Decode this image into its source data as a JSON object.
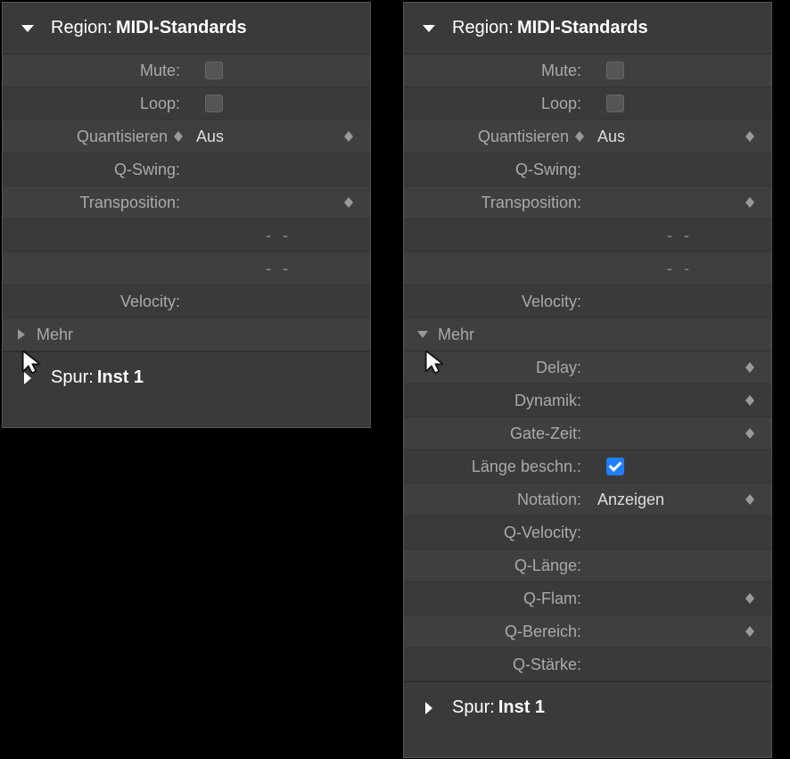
{
  "region": {
    "label": "Region:",
    "value": "MIDI-Standards"
  },
  "spur": {
    "label": "Spur:",
    "value": "Inst 1"
  },
  "mehr": {
    "label": "Mehr"
  },
  "dash": "-   -",
  "rows": {
    "mute": "Mute:",
    "loop": "Loop:",
    "quant": "Quantisieren",
    "quant_val": "Aus",
    "qswing": "Q-Swing:",
    "transp": "Transposition:",
    "velocity": "Velocity:",
    "delay": "Delay:",
    "dynamik": "Dynamik:",
    "gate": "Gate-Zeit:",
    "clip": "Länge beschn.:",
    "notation": "Notation:",
    "notation_val": "Anzeigen",
    "qvel": "Q-Velocity:",
    "qlen": "Q-Länge:",
    "qflam": "Q-Flam:",
    "qrange": "Q-Bereich:",
    "qstr": "Q-Stärke:"
  }
}
